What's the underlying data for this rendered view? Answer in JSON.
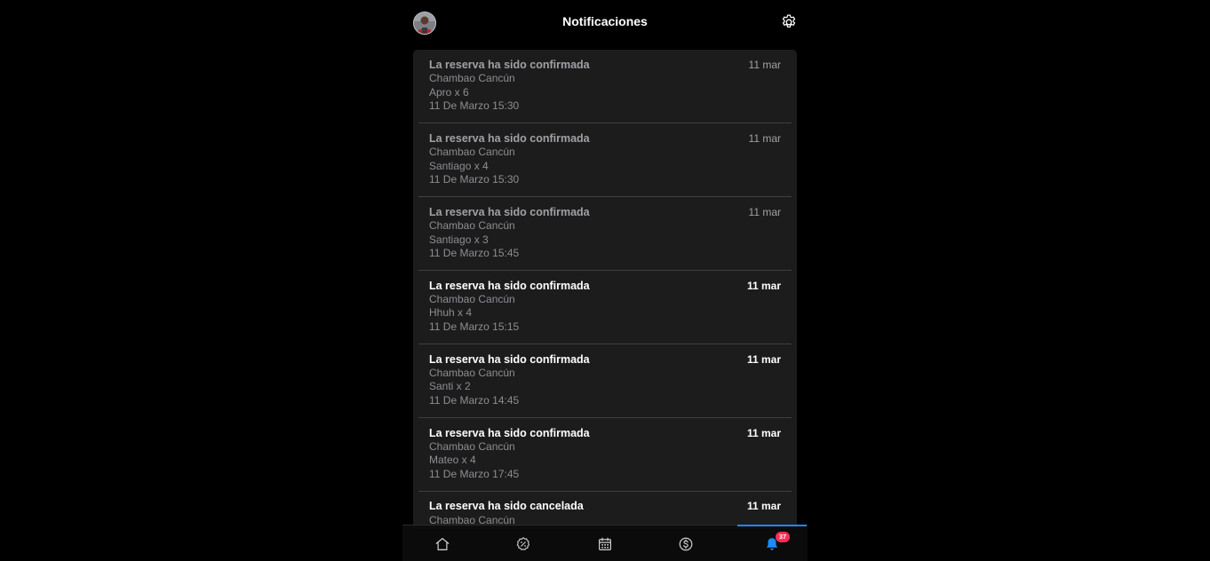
{
  "header": {
    "title": "Notificaciones",
    "avatar_icon": "user-avatar-icon",
    "settings_icon": "gear-icon"
  },
  "notifications": [
    {
      "title": "La reserva ha sido confirmada",
      "restaurant": "Chambao Cancún",
      "guest": "Apro x 6",
      "datetime": "11 De Marzo 15:30",
      "date": "11 mar",
      "read": true
    },
    {
      "title": "La reserva ha sido confirmada",
      "restaurant": "Chambao Cancún",
      "guest": "Santiago x 4",
      "datetime": "11 De Marzo 15:30",
      "date": "11 mar",
      "read": true
    },
    {
      "title": "La reserva ha sido confirmada",
      "restaurant": "Chambao Cancún",
      "guest": "Santiago x 3",
      "datetime": "11 De Marzo 15:45",
      "date": "11 mar",
      "read": true
    },
    {
      "title": "La reserva ha sido confirmada",
      "restaurant": "Chambao Cancún",
      "guest": "Hhuh x 4",
      "datetime": "11 De Marzo 15:15",
      "date": "11 mar",
      "read": false
    },
    {
      "title": "La reserva ha sido confirmada",
      "restaurant": "Chambao Cancún",
      "guest": "Santi x 2",
      "datetime": "11 De Marzo 14:45",
      "date": "11 mar",
      "read": false
    },
    {
      "title": "La reserva ha sido confirmada",
      "restaurant": "Chambao Cancún",
      "guest": "Mateo x 4",
      "datetime": "11 De Marzo 17:45",
      "date": "11 mar",
      "read": false
    },
    {
      "title": "La reserva ha sido cancelada",
      "restaurant": "Chambao Cancún",
      "guest": "",
      "datetime": "",
      "date": "11 mar",
      "read": false
    }
  ],
  "bottom_nav": {
    "items": [
      {
        "icon": "home-icon",
        "active": false
      },
      {
        "icon": "discount-icon",
        "active": false
      },
      {
        "icon": "calendar-icon",
        "active": false
      },
      {
        "icon": "dollar-icon",
        "active": false
      },
      {
        "icon": "bell-icon",
        "active": true,
        "badge": "37"
      }
    ]
  },
  "colors": {
    "background": "#000000",
    "card": "#1c1c1d",
    "divider": "#3f3f41",
    "accent": "#1a8cff",
    "badge": "#ff2d55"
  }
}
